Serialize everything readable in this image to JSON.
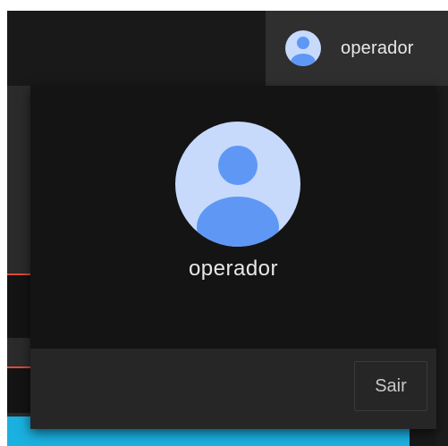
{
  "header": {
    "user_chip": {
      "username": "operador",
      "avatar_icon": "user-avatar-icon"
    }
  },
  "account_popup": {
    "username": "operador",
    "avatar_icon": "user-avatar-icon",
    "signout_label": "Sair"
  },
  "colors": {
    "avatar_bg": "#c7dafc",
    "avatar_fg": "#5f97f5",
    "popup_bg": "#141414",
    "footer_bg": "#262626",
    "chip_bg": "#2f2f2f",
    "accent_red": "#e04a3a",
    "accent_cyan": "#1ab0e0"
  }
}
